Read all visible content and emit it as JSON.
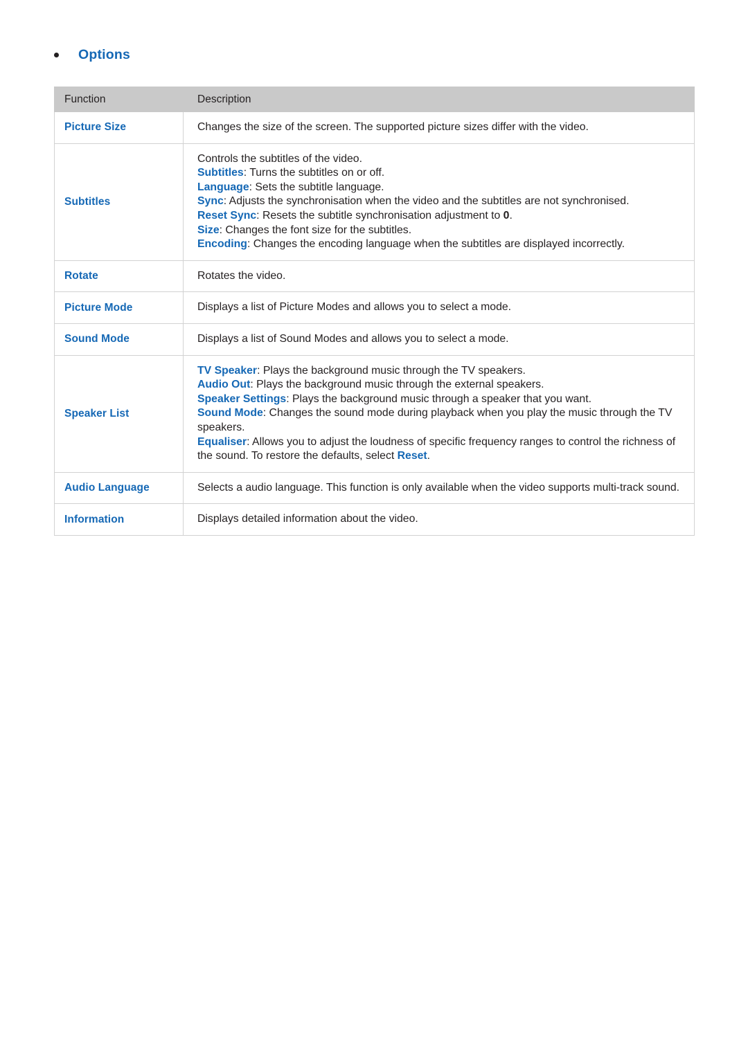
{
  "heading": {
    "bullet": "•",
    "label": "Options"
  },
  "table": {
    "columns": {
      "function": "Function",
      "description": "Description"
    },
    "rows": [
      {
        "function": "Picture Size",
        "lines": [
          {
            "text": "Changes the size of the screen. The supported picture sizes differ with the video."
          }
        ]
      },
      {
        "function": "Subtitles",
        "lines": [
          {
            "text": "Controls the subtitles of the video."
          },
          {
            "keyword": "Subtitles",
            "text": ": Turns the subtitles on or off."
          },
          {
            "keyword": "Language",
            "text": ": Sets the subtitle language."
          },
          {
            "keyword": "Sync",
            "text": ": Adjusts the synchronisation when the video and the subtitles are not synchronised."
          },
          {
            "keyword": "Reset Sync",
            "text": ": Resets the subtitle synchronisation adjustment to ",
            "emphasis": "0",
            "tail": "."
          },
          {
            "keyword": "Size",
            "text": ": Changes the font size for the subtitles."
          },
          {
            "keyword": "Encoding",
            "text": ": Changes the encoding language when the subtitles are displayed incorrectly."
          }
        ]
      },
      {
        "function": "Rotate",
        "lines": [
          {
            "text": "Rotates the video."
          }
        ]
      },
      {
        "function": "Picture Mode",
        "lines": [
          {
            "text": "Displays a list of Picture Modes and allows you to select a mode."
          }
        ]
      },
      {
        "function": "Sound Mode",
        "lines": [
          {
            "text": "Displays a list of Sound Modes and allows you to select a mode."
          }
        ]
      },
      {
        "function": "Speaker List",
        "lines": [
          {
            "keyword": "TV Speaker",
            "text": ": Plays the background music through the TV speakers."
          },
          {
            "keyword": "Audio Out",
            "text": ": Plays the background music through the external speakers."
          },
          {
            "keyword": "Speaker Settings",
            "text": ": Plays the background music through a speaker that you want."
          },
          {
            "keyword": "Sound Mode",
            "text": ": Changes the sound mode during playback when you play the music through the TV speakers."
          },
          {
            "keyword": "Equaliser",
            "text": ": Allows you to adjust the loudness of specific frequency ranges to control the richness of the sound. To restore the defaults, select ",
            "keyword_tail": "Reset",
            "tail": "."
          }
        ]
      },
      {
        "function": "Audio Language",
        "lines": [
          {
            "text": "Selects a audio language. This function is only available when the video supports multi-track sound."
          }
        ]
      },
      {
        "function": "Information",
        "lines": [
          {
            "text": "Displays detailed information about the video."
          }
        ]
      }
    ]
  },
  "colors": {
    "accent_blue": "#1568b5",
    "header_bg": "#c9c9c9",
    "border": "#d2d2d2",
    "text": "#231f20"
  }
}
